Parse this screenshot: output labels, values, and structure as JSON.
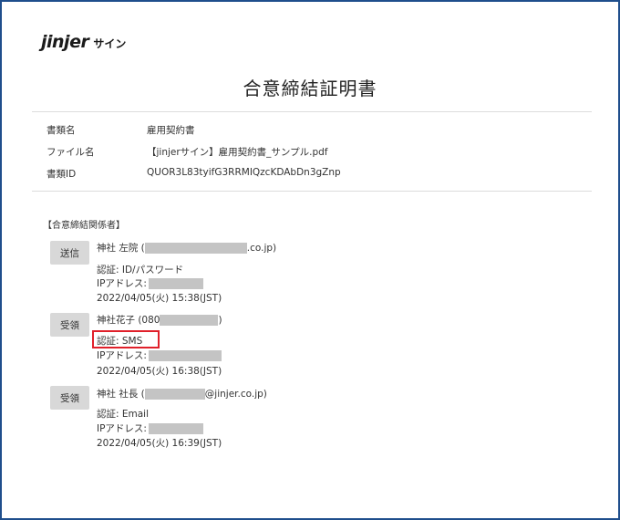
{
  "brand": {
    "logo_text": "jinjer",
    "logo_sub": "サイン"
  },
  "document_title": "合意締結証明書",
  "meta": [
    {
      "label": "書類名",
      "value": "雇用契約書"
    },
    {
      "label": "ファイル名",
      "value": "【jinjerサイン】雇用契約書_サンプル.pdf"
    },
    {
      "label": "書類ID",
      "value": "QUOR3L83tyifG3RRMIQzcKDAbDn3gZnp"
    }
  ],
  "parties_heading": "【合意締結関係者】",
  "parties": [
    {
      "role": "送信",
      "name_prefix": "神社 左院 (",
      "name_suffix": ".co.jp)",
      "auth": "認証: ID/パスワード",
      "ip_label": "IPアドレス:",
      "datetime": "2022/04/05(火) 15:38(JST)"
    },
    {
      "role": "受領",
      "name_prefix": "神社花子 (080",
      "name_suffix": ")",
      "auth": "認証: SMS",
      "ip_label": "IPアドレス:",
      "datetime": "2022/04/05(火) 16:38(JST)"
    },
    {
      "role": "受領",
      "name_prefix": "神社 社長 (",
      "name_suffix": "@jinjer.co.jp)",
      "auth": "認証: Email",
      "ip_label": "IPアドレス:",
      "datetime": "2022/04/05(火) 16:39(JST)"
    }
  ],
  "colors": {
    "frame": "#1f4e8c",
    "highlight": "#e0202a",
    "redaction": "#c4c4c4",
    "role_button": "#d8d8d8"
  }
}
